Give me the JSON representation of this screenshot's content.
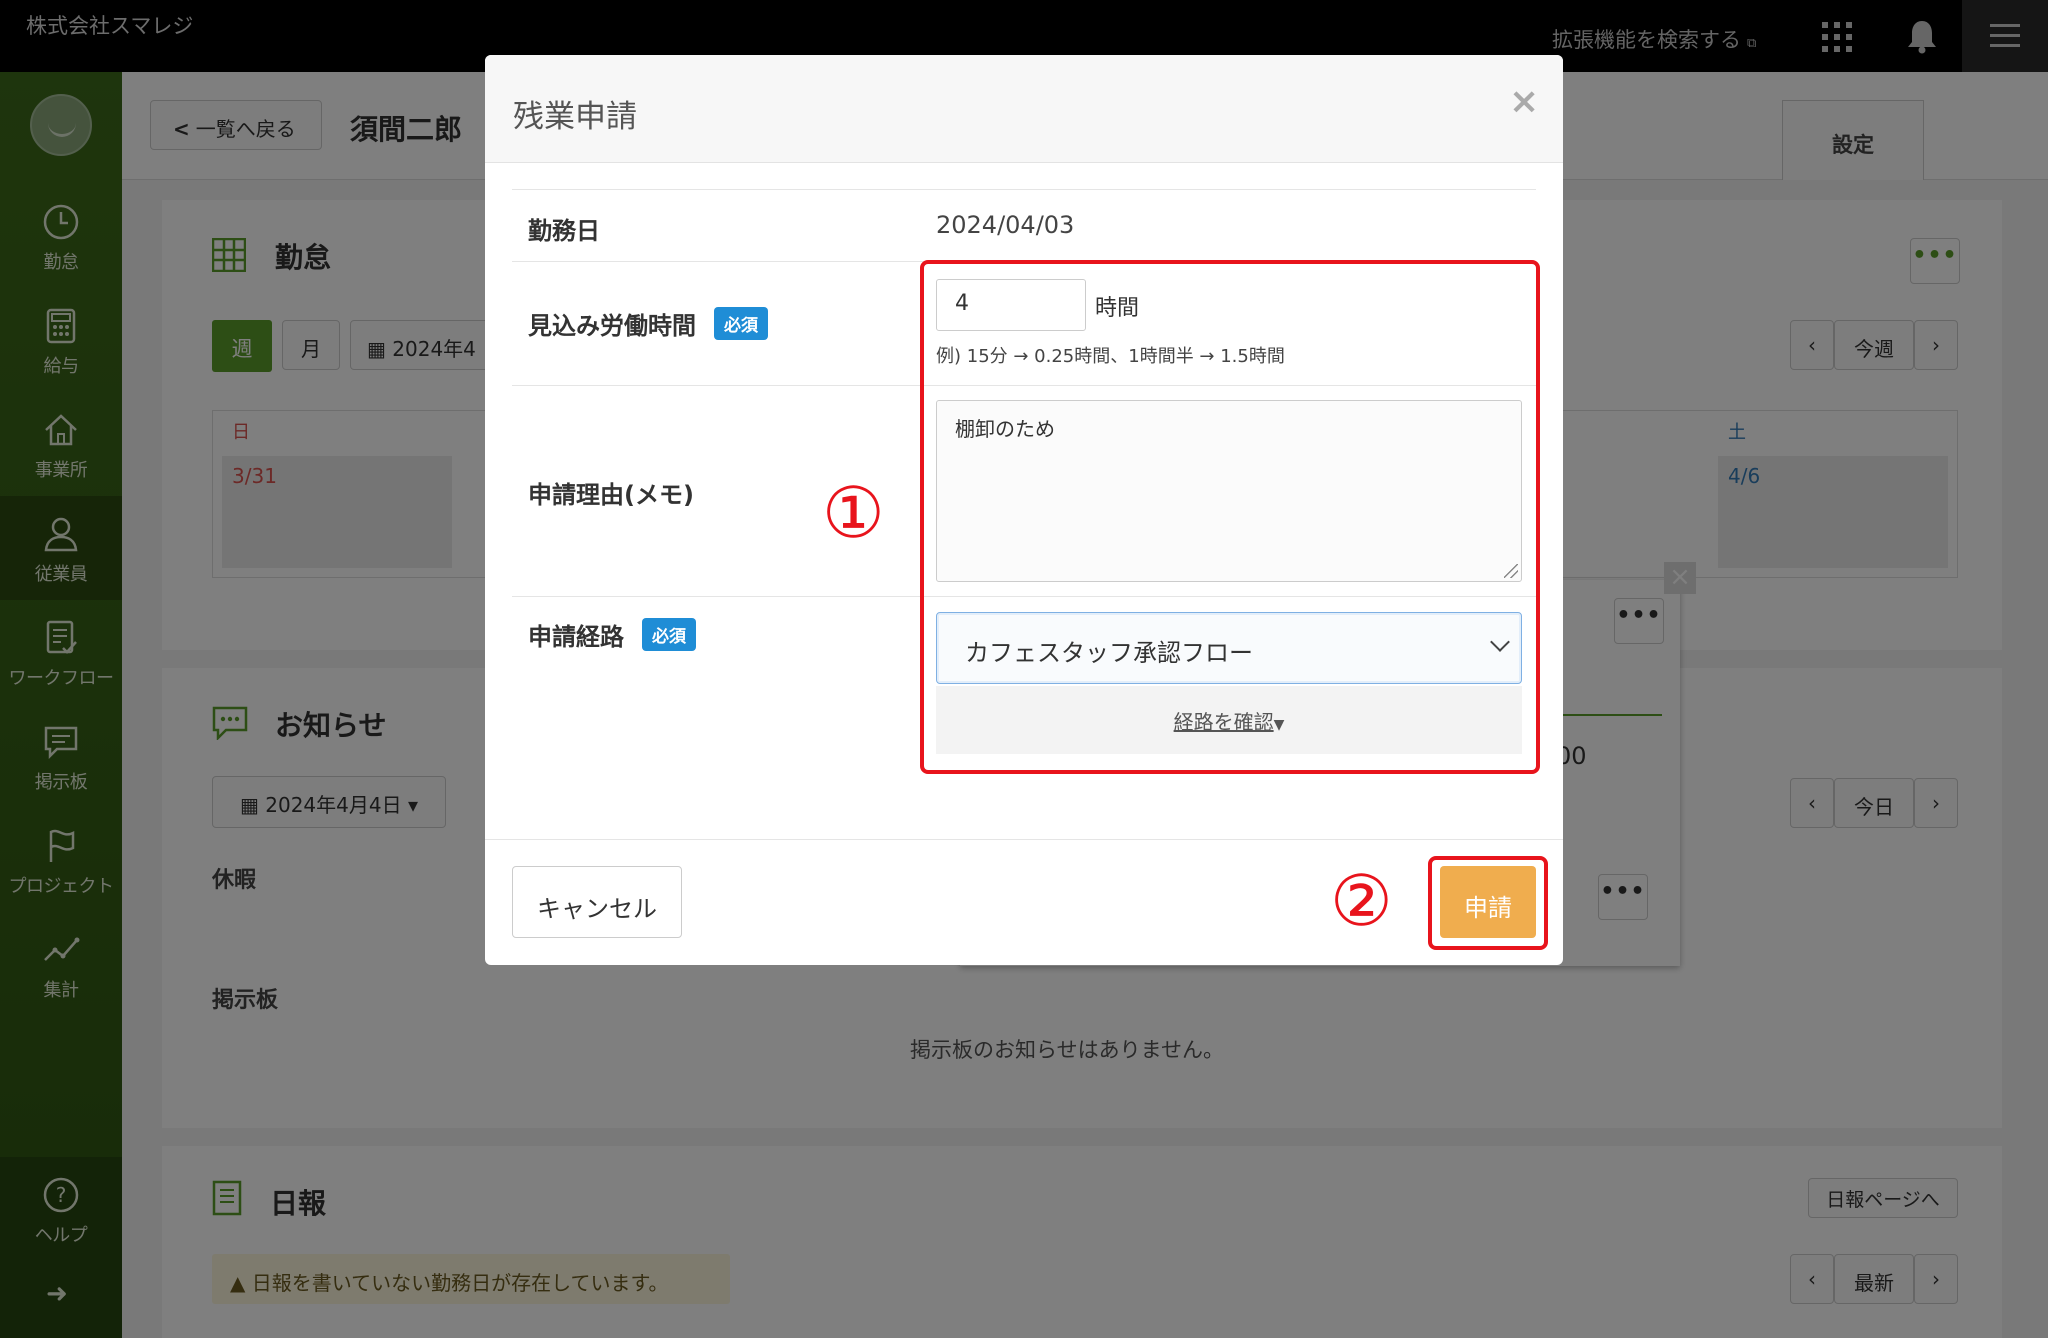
{
  "topbar": {
    "company": "株式会社スマレジ",
    "extension_search": "拡張機能を検索する",
    "icons": [
      "external-link-icon",
      "apps-grid-icon",
      "bell-icon",
      "hamburger-menu-icon"
    ]
  },
  "sidebar": {
    "items": [
      {
        "label": "勤怠",
        "icon": "clock-icon"
      },
      {
        "label": "給与",
        "icon": "calculator-icon"
      },
      {
        "label": "事業所",
        "icon": "home-icon"
      },
      {
        "label": "従業員",
        "icon": "person-icon"
      },
      {
        "label": "ワークフロー",
        "icon": "checklist-icon"
      },
      {
        "label": "掲示板",
        "icon": "chat-icon"
      },
      {
        "label": "プロジェクト",
        "icon": "flag-icon"
      },
      {
        "label": "集計",
        "icon": "chart-line-icon"
      }
    ],
    "help": "ヘルプ",
    "collapse": "➜"
  },
  "header": {
    "back": "一覧へ戻る",
    "person": "須間二郎",
    "settings": "設定"
  },
  "attendance": {
    "title": "勤怠",
    "week": "週",
    "month": "月",
    "date_partial": "2024年4",
    "this_week": "今週",
    "day_sun": "日",
    "day_sat": "土",
    "date_sun": "3/31",
    "date_sat": "4/6",
    "partial_time": "00"
  },
  "notices": {
    "title": "お知らせ",
    "date": "2024年4月4日",
    "today": "今日",
    "vacation": "休暇",
    "board": "掲示板",
    "no_board": "掲示板のお知らせはありません。"
  },
  "daily_report": {
    "title": "日報",
    "to_page": "日報ページへ",
    "warning": "日報を書いていない勤務日が存在しています。",
    "latest": "最新"
  },
  "modal": {
    "title": "残業申請",
    "close": "×",
    "work_date_label": "勤務日",
    "work_date_value": "2024/04/03",
    "hours_label": "見込み労働時間",
    "required": "必須",
    "hours_value": "4",
    "hours_unit": "時間",
    "hint": "例) 15分 → 0.25時間、1時間半 → 1.5時間",
    "reason_label": "申請理由(メモ)",
    "reason_value": "棚卸のため",
    "route_label": "申請経路",
    "route_value": "カフェスタッフ承認フロー",
    "route_check": "経路を確認",
    "cancel": "キャンセル",
    "submit": "申請"
  },
  "annotations": {
    "step1": "①",
    "step2": "②",
    "color": "#e8141c"
  }
}
